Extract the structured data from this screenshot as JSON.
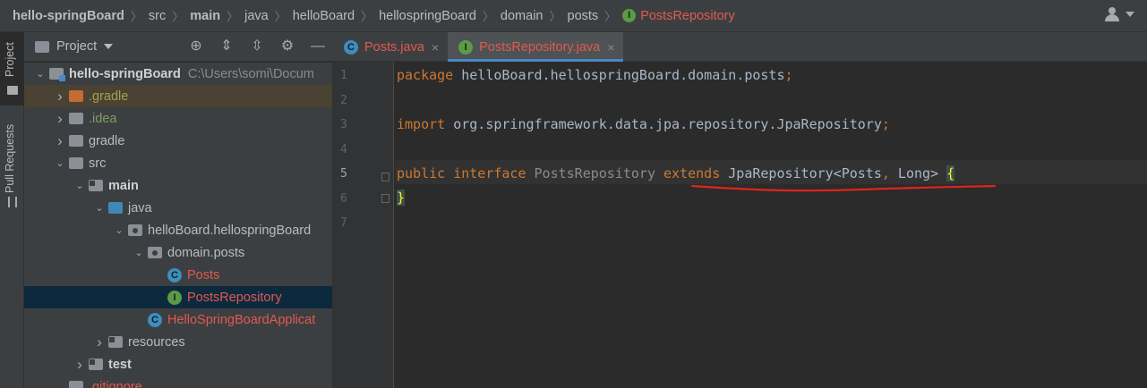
{
  "breadcrumb": [
    {
      "label": "hello-springBoard",
      "style": "bold"
    },
    {
      "label": "src",
      "style": ""
    },
    {
      "label": "main",
      "style": "bold"
    },
    {
      "label": "java",
      "style": ""
    },
    {
      "label": "helloBoard",
      "style": ""
    },
    {
      "label": "hellospringBoard",
      "style": ""
    },
    {
      "label": "domain",
      "style": ""
    },
    {
      "label": "posts",
      "style": ""
    },
    {
      "label": "PostsRepository",
      "style": "red",
      "icon": "interface-icon"
    }
  ],
  "sidebar": {
    "tabs": [
      {
        "label": "Project",
        "icon": "folder-icon"
      },
      {
        "label": "Pull Requests",
        "icon": "pull-request-icon"
      }
    ]
  },
  "project_panel": {
    "title": "Project",
    "toolbar_icons": [
      "locate-icon",
      "expand-all-icon",
      "collapse-all-icon",
      "gear-icon",
      "minimize-icon"
    ],
    "tree": [
      {
        "label": "hello-springBoard",
        "path": "C:\\Users\\somi\\Docum",
        "indent": 0,
        "arrow": "down",
        "icon": "module-folder",
        "style": "b"
      },
      {
        "label": ".gradle",
        "indent": 1,
        "arrow": "right",
        "icon": "orange-folder",
        "style": "yel",
        "highlight": "dir"
      },
      {
        "label": ".idea",
        "indent": 1,
        "arrow": "right",
        "icon": "grey-folder",
        "style": "grn"
      },
      {
        "label": "gradle",
        "indent": 1,
        "arrow": "right",
        "icon": "grey-folder",
        "style": ""
      },
      {
        "label": "src",
        "indent": 1,
        "arrow": "down",
        "icon": "grey-folder",
        "style": ""
      },
      {
        "label": "main",
        "indent": 2,
        "arrow": "down",
        "icon": "source-folder",
        "style": "b"
      },
      {
        "label": "java",
        "indent": 3,
        "arrow": "down",
        "icon": "blue-folder",
        "style": ""
      },
      {
        "label": "helloBoard.hellospringBoard",
        "indent": 4,
        "arrow": "down",
        "icon": "package",
        "style": ""
      },
      {
        "label": "domain.posts",
        "indent": 5,
        "arrow": "down",
        "icon": "package",
        "style": ""
      },
      {
        "label": "Posts",
        "indent": 6,
        "arrow": "",
        "icon": "class-c",
        "style": "red"
      },
      {
        "label": "PostsRepository",
        "indent": 6,
        "arrow": "",
        "icon": "class-i",
        "style": "red",
        "highlight": "sel"
      },
      {
        "label": "HelloSpringBoardApplicat",
        "indent": 5,
        "arrow": "",
        "icon": "class-c",
        "style": "red"
      },
      {
        "label": "resources",
        "indent": 3,
        "arrow": "right",
        "icon": "source-folder",
        "style": ""
      },
      {
        "label": "test",
        "indent": 2,
        "arrow": "right",
        "icon": "source-folder",
        "style": "b"
      },
      {
        "label": ".gitignore",
        "indent": 1,
        "arrow": "",
        "icon": "grey-folder",
        "style": "red"
      }
    ]
  },
  "editor": {
    "tabs": [
      {
        "label": "Posts.java",
        "icon": "C",
        "active": false
      },
      {
        "label": "PostsRepository.java",
        "icon": "I",
        "active": true
      }
    ],
    "close_glyph": "×",
    "line_numbers": [
      "1",
      "2",
      "3",
      "4",
      "5",
      "6",
      "7"
    ],
    "current_line": 5,
    "lines": {
      "l1_kw": "package",
      "l1_rest": " helloBoard.hellospringBoard.domain.posts",
      "l1_semi": ";",
      "l3_kw": "import",
      "l3_rest": " org.springframework.data.jpa.repository.JpaRepository",
      "l3_semi": ";",
      "l5_kw1": "public",
      "l5_kw2": "interface",
      "l5_name": "PostsRepository",
      "l5_kw3": "extends",
      "l5_type": "JpaRepository<Posts",
      "l5_comma": ",",
      "l5_type2": " Long> ",
      "l5_brace": "{",
      "l6_brace": "}"
    },
    "annotation_color": "#e0241b"
  }
}
